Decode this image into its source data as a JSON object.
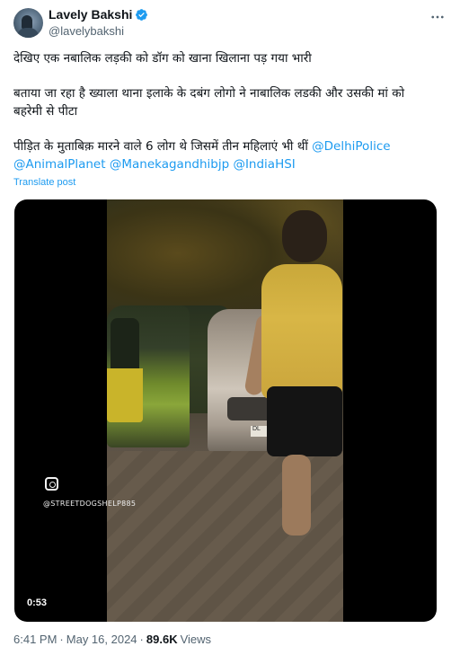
{
  "author": {
    "display_name": "Lavely Bakshi",
    "handle": "@lavelybakshi",
    "verified": true,
    "verified_color": "#1d9bf0"
  },
  "tweet": {
    "line1": "देखिए एक नबालिक लड़की को डॉग को खाना खिलाना पड़ गया भारी",
    "line2a": "बताया जा रहा है ख्याला थाना इलाके के दबंग लोगो ने नाबालिक लडकी और उसकी मां को",
    "line2b": "बहरेमी से पीटा",
    "line3": "पीड़ित के मुताबिक़ मारने वाले 6 लोग थे जिसमें तीन महिलाएं भी थीं",
    "mentions": [
      "@DelhiPolice",
      "@AnimalPlanet",
      "@Manekagandhibjp",
      "@IndiaHSI"
    ],
    "translate_label": "Translate post"
  },
  "media": {
    "duration": "0:53",
    "watermark": "@STREETDOGSHELP885",
    "plate_text": "DL"
  },
  "meta": {
    "time": "6:41 PM",
    "separator": "·",
    "date": "May 16, 2024",
    "views_count": "89.6K",
    "views_label": "Views"
  },
  "colors": {
    "link": "#1d9bf0",
    "text": "#0f1419",
    "secondary": "#536471"
  }
}
